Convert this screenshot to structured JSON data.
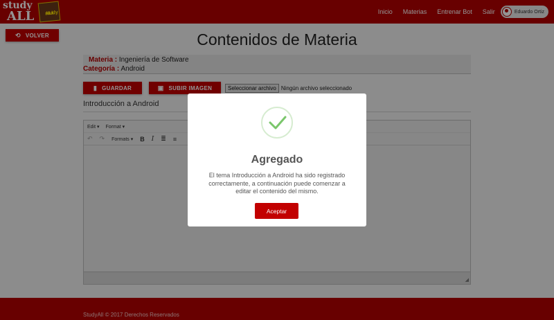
{
  "brand": {
    "line1": "study",
    "line2": "ALL",
    "book_text_1": "study",
    "book_text_2": "ALL"
  },
  "nav": {
    "links": [
      "Inicio",
      "Materias",
      "Entrenar Bot",
      "Salir"
    ],
    "user_name": "Eduardo Ortiz"
  },
  "back_button": {
    "label": "VOLVER",
    "icon": "history-icon"
  },
  "page": {
    "title": "Contenidos de Materia"
  },
  "subject": {
    "materia_label": "Materia :",
    "materia_value": "Ingeniería de Software",
    "categoria_label": "Categoría :",
    "categoria_value": "Android"
  },
  "actions": {
    "save_label": "GUARDAR",
    "upload_label": "SUBIR IMAGEN",
    "file_button": "Seleccionar archivo",
    "file_status": "Ningún archivo seleccionado"
  },
  "topic": {
    "title": "Introducción a Android"
  },
  "editor": {
    "menus": [
      "Edit",
      "Format"
    ],
    "formats_label": "Formats"
  },
  "footer": {
    "text": "StudyAll © 2017 Derechos Reservados"
  },
  "modal": {
    "title": "Agregado",
    "message": "El tema Introducción a Android ha sido registrado correctamente, a continuación puede comenzar a editar el contenido del mismo.",
    "accept_label": "Aceptar",
    "icon": "success-check-icon"
  },
  "colors": {
    "primary": "#b30000",
    "button": "#c20000",
    "success": "#7ac66b"
  }
}
